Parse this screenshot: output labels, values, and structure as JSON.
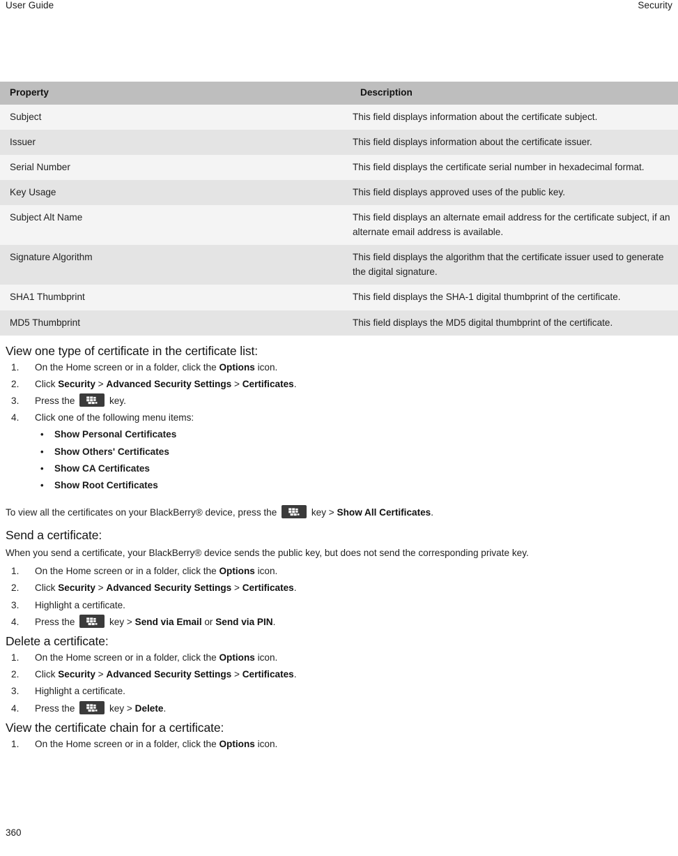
{
  "header": {
    "left": "User Guide",
    "right": "Security"
  },
  "footer": {
    "page_number": "360"
  },
  "table": {
    "columns": [
      "Property",
      "Description"
    ],
    "rows": [
      {
        "property": "Subject",
        "description": "This field displays information about the certificate subject."
      },
      {
        "property": "Issuer",
        "description": "This field displays information about the certificate issuer."
      },
      {
        "property": "Serial Number",
        "description": "This field displays the certificate serial number in hexadecimal format."
      },
      {
        "property": "Key Usage",
        "description": "This field displays approved uses of the public key."
      },
      {
        "property": "Subject Alt Name",
        "description": "This field displays an alternate email address for the certificate subject, if an alternate email address is available."
      },
      {
        "property": "Signature Algorithm",
        "description": "This field displays the algorithm that the certificate issuer used to generate the digital signature."
      },
      {
        "property": "SHA1 Thumbprint",
        "description": "This field displays the SHA-1 digital thumbprint of the certificate."
      },
      {
        "property": "MD5 Thumbprint",
        "description": "This field displays the MD5 digital thumbprint of the certificate."
      }
    ]
  },
  "sections": {
    "view_one_type": {
      "heading": "View one type of certificate in the certificate list:",
      "step1_a": "On the Home screen or in a folder, click the ",
      "step1_b": "Options",
      "step1_c": " icon.",
      "step2_a": "Click ",
      "step2_b": "Security",
      "step2_c": " > ",
      "step2_d": "Advanced Security Settings",
      "step2_e": " > ",
      "step2_f": "Certificates",
      "step2_g": ".",
      "step3_a": "Press the ",
      "step3_b": " key.",
      "step4": "Click one of the following menu items:",
      "menu_items": [
        "Show Personal Certificates",
        "Show Others' Certificates",
        "Show CA Certificates",
        "Show Root Certificates"
      ],
      "note_a": "To view all the certificates on your BlackBerry® device, press the ",
      "note_b": " key > ",
      "note_c": "Show All Certificates",
      "note_d": "."
    },
    "send_certificate": {
      "heading": "Send a certificate:",
      "intro": "When you send a certificate, your BlackBerry® device sends the public key, but does not send the corresponding private key.",
      "step1_a": "On the Home screen or in a folder, click the ",
      "step1_b": "Options",
      "step1_c": " icon.",
      "step2_a": "Click ",
      "step2_b": "Security",
      "step2_c": " > ",
      "step2_d": "Advanced Security Settings",
      "step2_e": " > ",
      "step2_f": "Certificates",
      "step2_g": ".",
      "step3": "Highlight a certificate.",
      "step4_a": "Press the ",
      "step4_b": " key > ",
      "step4_c": "Send via Email",
      "step4_d": " or ",
      "step4_e": "Send via PIN",
      "step4_f": "."
    },
    "delete_certificate": {
      "heading": "Delete a certificate:",
      "step1_a": "On the Home screen or in a folder, click the ",
      "step1_b": "Options",
      "step1_c": " icon.",
      "step2_a": "Click ",
      "step2_b": "Security",
      "step2_c": " > ",
      "step2_d": "Advanced Security Settings",
      "step2_e": " > ",
      "step2_f": "Certificates",
      "step2_g": ".",
      "step3": "Highlight a certificate.",
      "step4_a": "Press the ",
      "step4_b": " key > ",
      "step4_c": "Delete",
      "step4_d": "."
    },
    "view_chain": {
      "heading": "View the certificate chain for a certificate:",
      "step1_a": "On the Home screen or in a folder, click the ",
      "step1_b": "Options",
      "step1_c": " icon."
    }
  },
  "icons": {
    "menu_key": "blackberry-menu-key-icon"
  },
  "colors": {
    "table_header_bg": "#bebebe",
    "row_odd_bg": "#f4f4f4",
    "row_even_bg": "#e4e4e4",
    "text": "#1f1f1f",
    "key_icon_bg": "#3b3b3b"
  }
}
